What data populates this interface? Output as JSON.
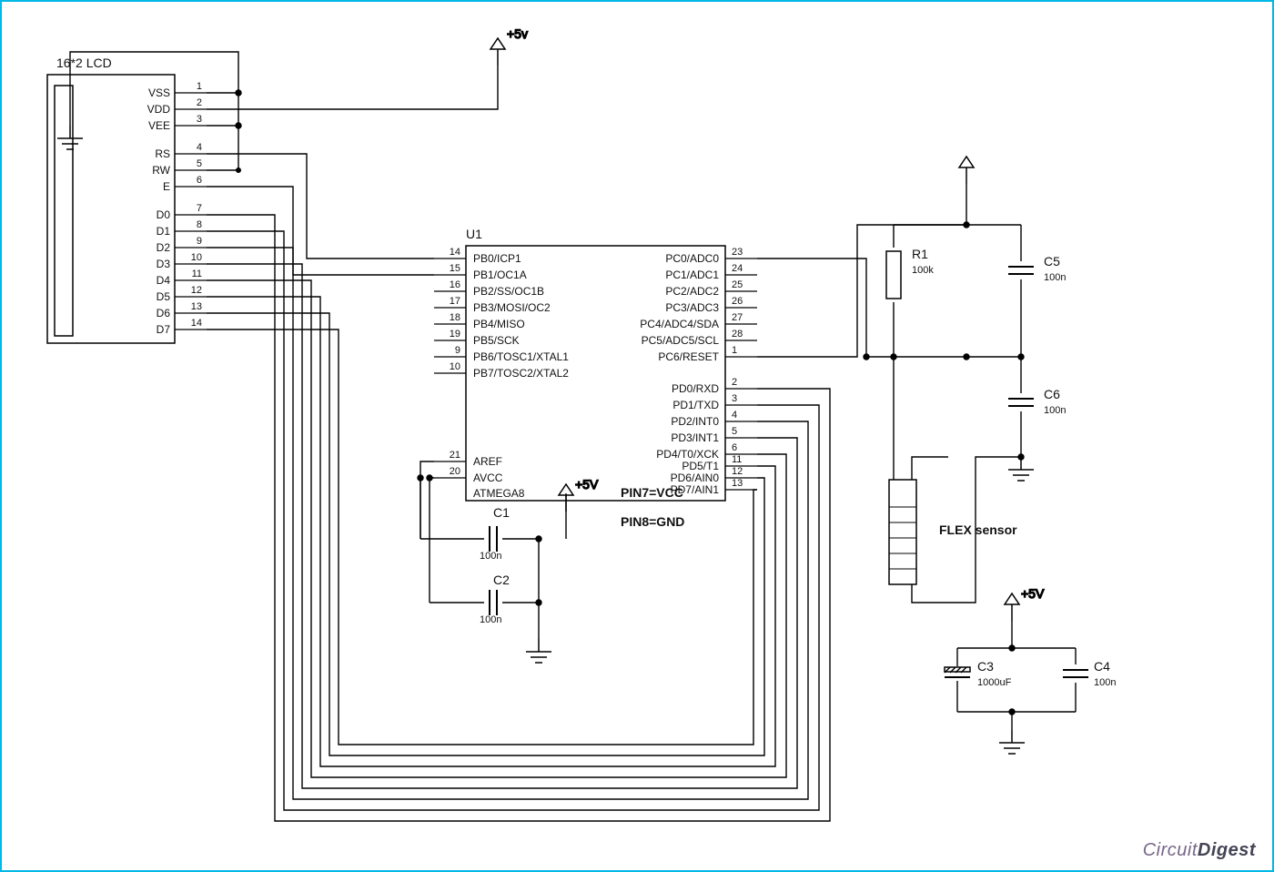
{
  "title": "16*2 LCD",
  "mcu": {
    "ref": "U1",
    "part": "ATMEGA8",
    "note_vcc": "PIN7=VCC",
    "note_gnd": "PIN8=GND",
    "left_pins": [
      {
        "n": "14",
        "name": "PB0/ICP1"
      },
      {
        "n": "15",
        "name": "PB1/OC1A"
      },
      {
        "n": "16",
        "name": "PB2/SS/OC1B"
      },
      {
        "n": "17",
        "name": "PB3/MOSI/OC2"
      },
      {
        "n": "18",
        "name": "PB4/MISO"
      },
      {
        "n": "19",
        "name": "PB5/SCK"
      },
      {
        "n": "9",
        "name": "PB6/TOSC1/XTAL1"
      },
      {
        "n": "10",
        "name": "PB7/TOSC2/XTAL2"
      }
    ],
    "left_pins2": [
      {
        "n": "21",
        "name": "AREF"
      },
      {
        "n": "20",
        "name": "AVCC"
      }
    ],
    "right_pins": [
      {
        "n": "23",
        "name": "PC0/ADC0"
      },
      {
        "n": "24",
        "name": "PC1/ADC1"
      },
      {
        "n": "25",
        "name": "PC2/ADC2"
      },
      {
        "n": "26",
        "name": "PC3/ADC3"
      },
      {
        "n": "27",
        "name": "PC4/ADC4/SDA"
      },
      {
        "n": "28",
        "name": "PC5/ADC5/SCL"
      },
      {
        "n": "1",
        "name": "PC6/RESET"
      }
    ],
    "right_pins2": [
      {
        "n": "2",
        "name": "PD0/RXD"
      },
      {
        "n": "3",
        "name": "PD1/TXD"
      },
      {
        "n": "4",
        "name": "PD2/INT0"
      },
      {
        "n": "5",
        "name": "PD3/INT1"
      },
      {
        "n": "6",
        "name": "PD4/T0/XCK"
      },
      {
        "n": "11",
        "name": "PD5/T1"
      },
      {
        "n": "12",
        "name": "PD6/AIN0"
      },
      {
        "n": "13",
        "name": "PD7/AIN1"
      }
    ]
  },
  "lcd": {
    "label": "16*2 LCD",
    "pins": [
      {
        "n": "1",
        "name": "VSS"
      },
      {
        "n": "2",
        "name": "VDD"
      },
      {
        "n": "3",
        "name": "VEE"
      },
      {
        "n": "4",
        "name": "RS"
      },
      {
        "n": "5",
        "name": "RW"
      },
      {
        "n": "6",
        "name": "E"
      },
      {
        "n": "7",
        "name": "D0"
      },
      {
        "n": "8",
        "name": "D1"
      },
      {
        "n": "9",
        "name": "D2"
      },
      {
        "n": "10",
        "name": "D3"
      },
      {
        "n": "11",
        "name": "D4"
      },
      {
        "n": "12",
        "name": "D5"
      },
      {
        "n": "13",
        "name": "D6"
      },
      {
        "n": "14",
        "name": "D7"
      }
    ]
  },
  "rails": {
    "v5": "+5V",
    "v5lc": "+5v"
  },
  "components": {
    "R1": {
      "ref": "R1",
      "val": "100k"
    },
    "C1": {
      "ref": "C1",
      "val": "100n"
    },
    "C2": {
      "ref": "C2",
      "val": "100n"
    },
    "C3": {
      "ref": "C3",
      "val": "1000uF"
    },
    "C4": {
      "ref": "C4",
      "val": "100n"
    },
    "C5": {
      "ref": "C5",
      "val": "100n"
    },
    "C6": {
      "ref": "C6",
      "val": "100n"
    }
  },
  "flex": {
    "label": "FLEX sensor"
  },
  "brand": {
    "a": "Circuit",
    "b": "Digest"
  }
}
